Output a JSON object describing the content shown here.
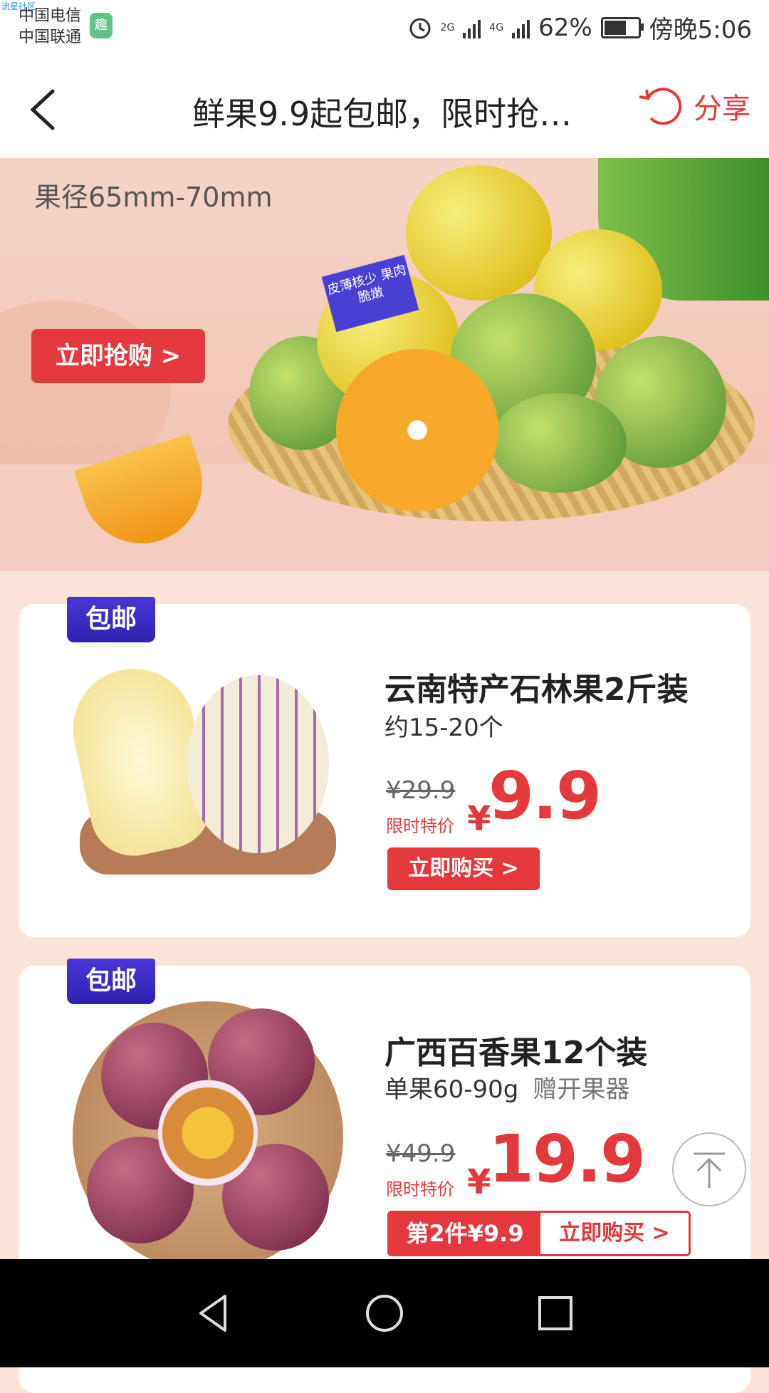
{
  "status_bar": {
    "watermark": "流星社区",
    "carrier1": "中国电信",
    "carrier2": "中国联通",
    "app_badge": "趣",
    "network1": "2G",
    "network2": "4G",
    "battery": "62%",
    "time": "傍晚5:06"
  },
  "header": {
    "title": "鲜果9.9起包邮，限时抢…",
    "share_label": "分享"
  },
  "banner": {
    "subtitle": "果径65mm-70mm",
    "tag": "皮薄核少 果肉脆嫩",
    "button": "立即抢购 >"
  },
  "products": [
    {
      "badge": "包邮",
      "name": "云南特产石林果2斤装",
      "spec": "约15-20个",
      "gift": "",
      "old_price": "¥29.9",
      "limit_label": "限时特价",
      "currency": "¥",
      "price": "9.9",
      "button": "立即购买 >"
    },
    {
      "badge": "包邮",
      "name": "广西百香果12个装",
      "spec": "单果60-90g",
      "gift": "赠开果器",
      "old_price": "¥49.9",
      "limit_label": "限时特价",
      "currency": "¥",
      "price": "19.9",
      "promo": "第2件¥9.9",
      "button": "立即购买 >"
    }
  ],
  "colors": {
    "accent": "#e4393c",
    "badge": "#3a2bc8"
  }
}
